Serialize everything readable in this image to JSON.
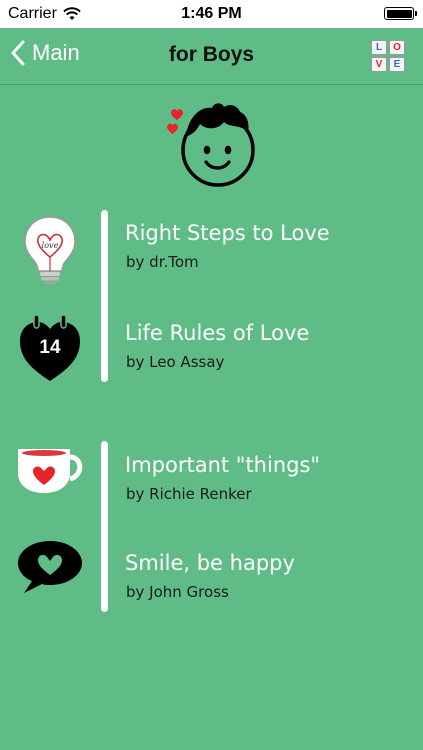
{
  "status_bar": {
    "carrier": "Carrier",
    "time": "1:46 PM"
  },
  "nav": {
    "back_label": "Main",
    "title": "for Boys",
    "logo_letters": [
      "L",
      "O",
      "V",
      "E"
    ]
  },
  "colors": {
    "background": "#5fbc87",
    "accent_red": "#e8242b",
    "text_light": "#ffffff",
    "text_dark": "#1b1b1b"
  },
  "books": [
    {
      "title": "Right Steps to Love",
      "author": "by dr.Tom",
      "icon": "lightbulb-heart-icon"
    },
    {
      "title": "Life Rules of Love",
      "author": "by Leo Assay",
      "icon": "calendar-heart-icon"
    },
    {
      "title": "Important \"things\"",
      "author": "by Richie Renker",
      "icon": "cup-heart-icon"
    },
    {
      "title": "Smile, be happy",
      "author": "by John Gross",
      "icon": "speech-bubble-heart-icon"
    }
  ],
  "calendar_day": "14"
}
